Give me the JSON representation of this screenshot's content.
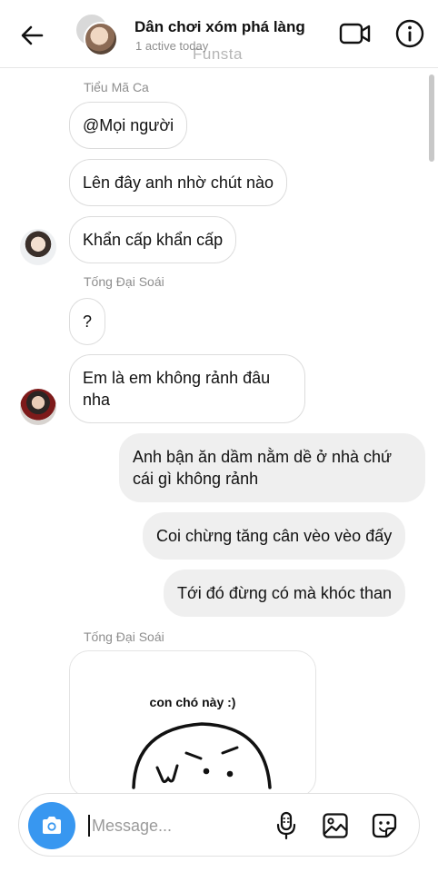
{
  "header": {
    "title": "Dân chơi xóm phá làng",
    "status": "1 active today",
    "watermark": "Funsta",
    "icons": {
      "back": "arrow-left-icon",
      "video": "video-camera-icon",
      "info": "info-icon"
    }
  },
  "messages": [
    {
      "sender": "Tiểu Mã Ca",
      "texts": [
        "@Mọi người",
        "Lên đây anh nhờ chút nào",
        "Khẩn cấp khẩn cấp"
      ]
    },
    {
      "sender": "Tống Đại Soái",
      "texts": [
        "?",
        "Em là em không rảnh đâu nha"
      ]
    },
    {
      "sender": "me",
      "texts": [
        "Anh bận ăn dầm nằm dề ở nhà chứ cái gì không rảnh",
        "Coi chừng tăng cân vèo vèo đấy",
        "Tới đó đừng có mà khóc than"
      ]
    },
    {
      "sender": "Tống Đại Soái",
      "image_caption": "con chó này :)"
    }
  ],
  "composer": {
    "placeholder": "Message...",
    "icons": {
      "camera": "camera-icon",
      "mic": "microphone-icon",
      "gallery": "image-icon",
      "sticker": "sticker-icon"
    }
  },
  "colors": {
    "accent": "#3897f0",
    "my_bubble": "#efefef",
    "meta_text": "#8e8e8e"
  }
}
